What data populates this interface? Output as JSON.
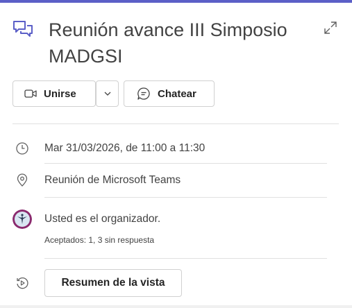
{
  "meeting": {
    "title": "Reunión avance III Simposio MADGSI"
  },
  "actions": {
    "join_label": "Unirse",
    "chat_label": "Chatear"
  },
  "details": {
    "datetime": "Mar 31/03/2026, de 11:00 a 11:30",
    "location": "Reunión de Microsoft Teams",
    "organizer_text": "Usted es el organizador.",
    "attendance": "Aceptados: 1, 3 sin respuesta",
    "summary_label": "Resumen de la vista"
  },
  "icons": {
    "title": "chat-bubbles-icon",
    "expand": "expand-diagonal-icon",
    "join": "video-camera-icon",
    "dropdown": "chevron-down-icon",
    "chat": "chat-bubble-icon",
    "datetime": "clock-icon",
    "location": "location-pin-icon",
    "summary": "replay-icon"
  },
  "colors": {
    "accent": "#5b5fc7",
    "text": "#242424",
    "muted_text": "#424242",
    "border": "#d1d1d1"
  }
}
